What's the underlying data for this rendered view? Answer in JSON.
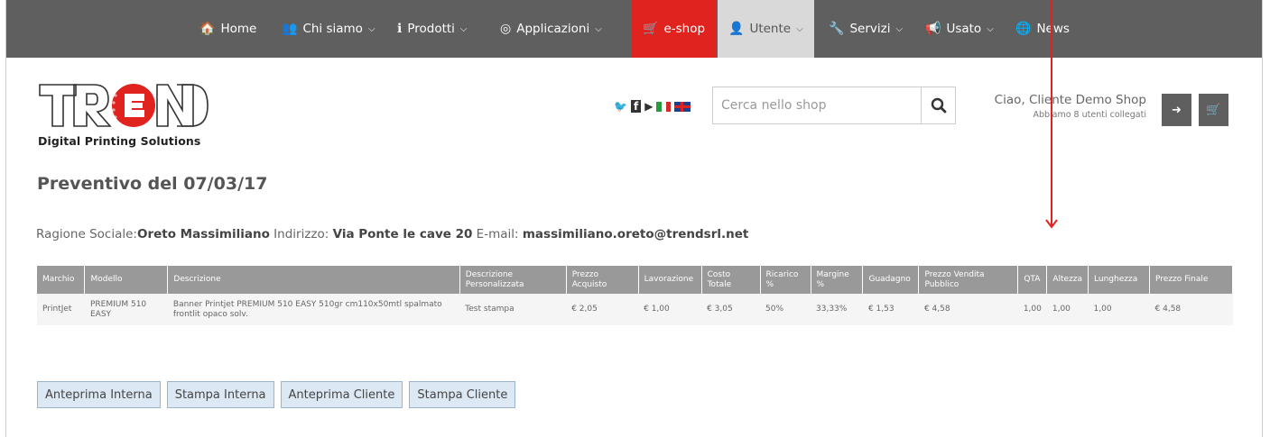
{
  "nav": [
    {
      "icon": "home-icon",
      "glyph": "🏠",
      "label": "Home",
      "has_menu": false
    },
    {
      "icon": "users-icon",
      "glyph": "👥",
      "label": "Chi siamo",
      "has_menu": true
    },
    {
      "icon": "info-icon",
      "glyph": "ℹ",
      "label": "Prodotti",
      "has_menu": true
    },
    {
      "icon": "target-icon",
      "glyph": "◎",
      "label": "Applicazioni",
      "has_menu": true
    },
    {
      "icon": "cart-icon",
      "glyph": "🛒",
      "label": "e-shop",
      "has_menu": false
    },
    {
      "icon": "user-icon",
      "glyph": "👤",
      "label": "Utente",
      "has_menu": true
    },
    {
      "icon": "wrench-icon",
      "glyph": "🔧",
      "label": "Servizi",
      "has_menu": true
    },
    {
      "icon": "megaphone-icon",
      "glyph": "📢",
      "label": "Usato",
      "has_menu": true
    },
    {
      "icon": "globe-icon",
      "glyph": "🌐",
      "label": "News",
      "has_menu": false
    }
  ],
  "logo": {
    "letters": "TREND",
    "tagline": "Digital Printing Solutions"
  },
  "social": {
    "twitter": "🐦",
    "facebook": "f",
    "youtube": "▶"
  },
  "search": {
    "placeholder": "Cerca nello shop"
  },
  "greeting": {
    "name": "Ciao, Cliente Demo Shop",
    "sub": "Abbiamo 8 utenti collegati"
  },
  "page_title": "Preventivo del 07/03/17",
  "client": {
    "ragione_label": "Ragione Sociale:",
    "ragione_value": "Oreto Massimiliano",
    "indirizzo_label": " Indirizzo: ",
    "indirizzo_value": "Via Ponte le cave 20",
    "email_label": " E-mail: ",
    "email_value": "massimiliano.oreto@trendsrl.net"
  },
  "table": {
    "headers": [
      "Marchio",
      "Modello",
      "Descrizione",
      "Descrizione Personalizzata",
      "Prezzo Acquisto",
      "Lavorazione",
      "Costo Totale",
      "Ricarico %",
      "Margine %",
      "Guadagno",
      "Prezzo Vendita Pubblico",
      "QTA",
      "Altezza",
      "Lunghezza",
      "Prezzo Finale"
    ],
    "rows": [
      [
        "PrintJet",
        "PREMIUM 510 EASY",
        "Banner Printjet PREMIUM 510 EASY 510gr cm110x50mtl spalmato frontlit opaco solv.",
        "Test stampa",
        "€ 2,05",
        "€ 1,00",
        "€ 3,05",
        "50%",
        "33,33%",
        "€ 1,53",
        "€ 4,58",
        "1,00",
        "1,00",
        "1,00",
        "€ 4,58"
      ]
    ]
  },
  "buttons": [
    "Anteprima Interna",
    "Stampa Interna",
    "Anteprima Cliente",
    "Stampa Cliente"
  ],
  "colors": {
    "nav_bg": "#5f5f5f",
    "eshop_bg": "#e0231e",
    "utente_bg": "#d9d9d9",
    "table_header": "#999999",
    "annotation_arrow": "#e0231e"
  }
}
